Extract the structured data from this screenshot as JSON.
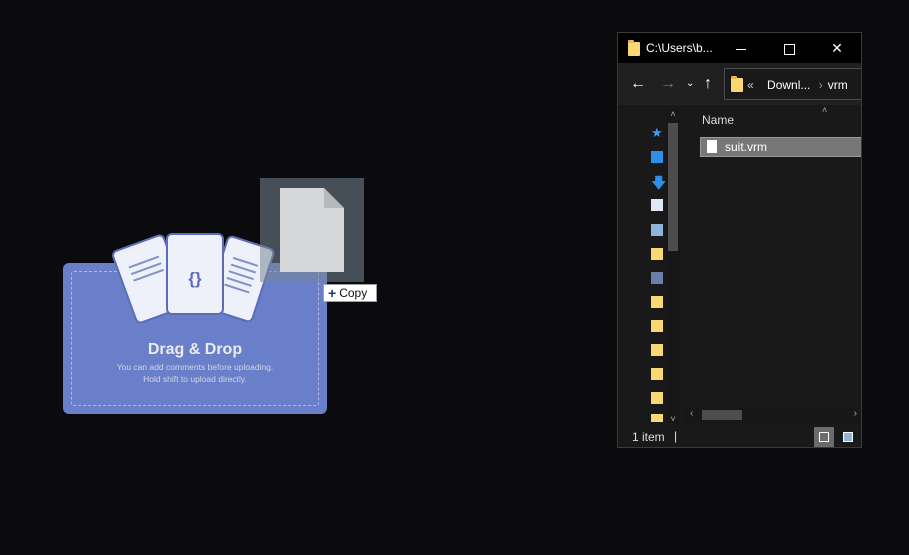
{
  "dropzone": {
    "title": "Drag & Drop",
    "subtitle_line1": "You can add comments before uploading.",
    "subtitle_line2": "Hold shift to upload directly.",
    "doc_center_symbol": "{}",
    "accent_color": "#7289da"
  },
  "drag_tooltip": {
    "label": "Copy",
    "icon": "plus-icon"
  },
  "explorer": {
    "window_title": "C:\\Users\\b...",
    "address": {
      "overflow": "«",
      "segments": [
        "Downl...",
        "vrm"
      ]
    },
    "column_header": "Name",
    "files": [
      {
        "name": "suit.vrm",
        "icon": "file-icon",
        "selected": true
      }
    ],
    "status": "1 item",
    "nav_icons": [
      "back-arrow-icon",
      "forward-arrow-icon",
      "recent-dropdown-icon",
      "up-arrow-icon"
    ],
    "navpane_icons": [
      "quick-access-star-icon",
      "desktop-icon",
      "downloads-icon",
      "documents-icon",
      "pictures-icon",
      "folder-icon",
      "video-icon",
      "folder-icon",
      "folder-icon",
      "folder-icon",
      "folder-icon",
      "folder-icon",
      "folder-icon",
      "folder-icon"
    ]
  }
}
